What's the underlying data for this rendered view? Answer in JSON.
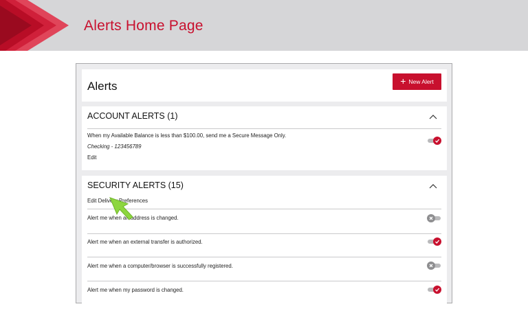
{
  "page": {
    "title": "Alerts Home Page"
  },
  "header_card": {
    "title": "Alerts",
    "new_alert_label": "New Alert"
  },
  "account_alerts": {
    "title": "ACCOUNT ALERTS (1)",
    "items": [
      {
        "text": "When my Available Balance is less than $100.00, send me a Secure Message Only.",
        "account": "Checking - 123456789",
        "edit_label": "Edit",
        "enabled": true
      }
    ]
  },
  "security_alerts": {
    "title": "SECURITY ALERTS (15)",
    "edit_preferences_label": "Edit Delivery Preferences",
    "items": [
      {
        "text": "Alert me when an address is changed.",
        "enabled": false
      },
      {
        "text": "Alert me when an external transfer is authorized.",
        "enabled": true
      },
      {
        "text": "Alert me when a computer/browser is successfully registered.",
        "enabled": false
      },
      {
        "text": "Alert me when my password is changed.",
        "enabled": true
      }
    ]
  },
  "colors": {
    "brand": "#c8102e",
    "banner": "#d6d6d8",
    "frame": "#ececee",
    "cursor": "#8dd63f"
  },
  "icons": [
    "plus-icon",
    "chevron-up-icon",
    "check-icon",
    "x-icon",
    "pointer-cursor"
  ]
}
